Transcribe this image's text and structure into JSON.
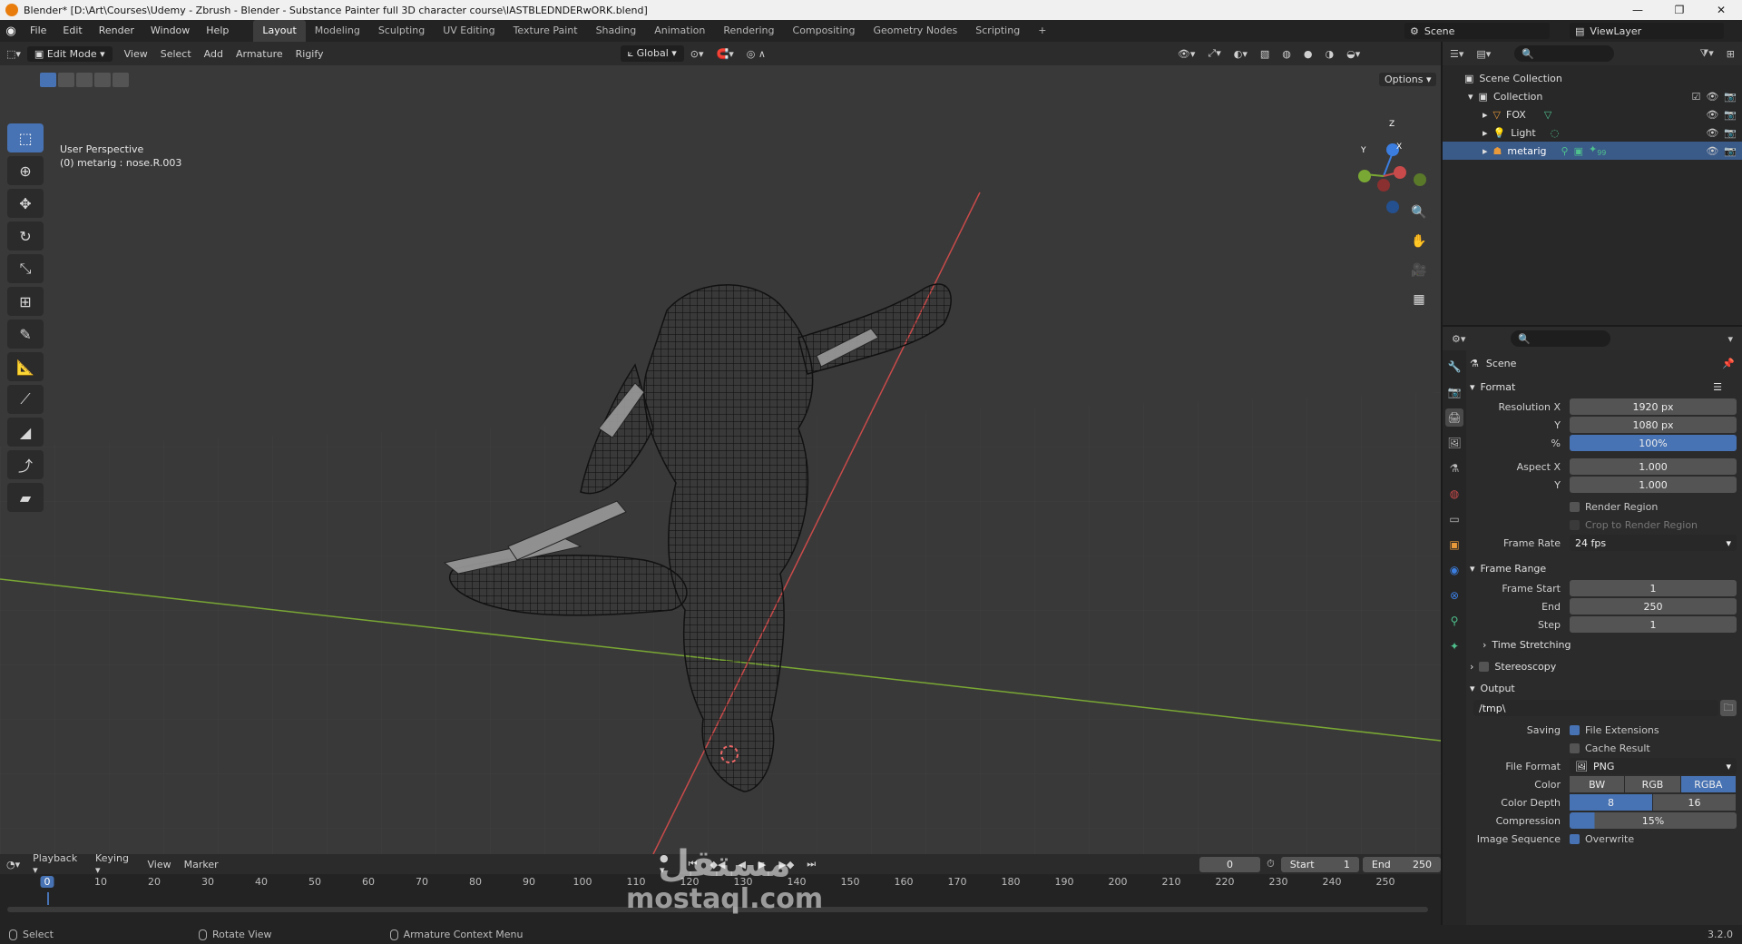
{
  "window": {
    "title": "Blender* [D:\\Art\\Courses\\Udemy - Zbrush - Blender - Substance Painter full 3D character course\\lASTBLEDNDERwORK.blend]",
    "minimize": "—",
    "maximize": "❐",
    "close": "✕"
  },
  "menu": [
    "File",
    "Edit",
    "Render",
    "Window",
    "Help"
  ],
  "workspaces": [
    "Layout",
    "Modeling",
    "Sculpting",
    "UV Editing",
    "Texture Paint",
    "Shading",
    "Animation",
    "Rendering",
    "Compositing",
    "Geometry Nodes",
    "Scripting"
  ],
  "workspace_add": "+",
  "scene_name": "Scene",
  "view_layer": "ViewLayer",
  "viewport": {
    "mode": "Edit Mode",
    "menus": [
      "View",
      "Select",
      "Add",
      "Armature",
      "Rigify"
    ],
    "orientation": "Global",
    "options": "Options",
    "perspective": "User Perspective",
    "active": "(0) metarig : nose.R.003",
    "gizmo": {
      "x": "X",
      "y": "Y",
      "z": "Z"
    }
  },
  "outliner": {
    "root": "Scene Collection",
    "collection": "Collection",
    "items": [
      "FOX",
      "Light",
      "metarig"
    ],
    "bone_count": "99"
  },
  "properties": {
    "context": "Scene",
    "format": {
      "title": "Format",
      "res_x_label": "Resolution X",
      "res_x": "1920 px",
      "res_y_label": "Y",
      "res_y": "1080 px",
      "pct_label": "%",
      "pct": "100%",
      "aspect_x_label": "Aspect X",
      "aspect_x": "1.000",
      "aspect_y_label": "Y",
      "aspect_y": "1.000",
      "render_region": "Render Region",
      "crop": "Crop to Render Region",
      "frame_rate_label": "Frame Rate",
      "frame_rate": "24 fps"
    },
    "frame_range": {
      "title": "Frame Range",
      "start_label": "Frame Start",
      "start": "1",
      "end_label": "End",
      "end": "250",
      "step_label": "Step",
      "step": "1",
      "time_stretching": "Time Stretching"
    },
    "stereoscopy": "Stereoscopy",
    "output": {
      "title": "Output",
      "path": "/tmp\\",
      "saving_label": "Saving",
      "file_ext": "File Extensions",
      "cache": "Cache Result",
      "file_format_label": "File Format",
      "file_format": "PNG",
      "color_label": "Color",
      "color_opts": [
        "BW",
        "RGB",
        "RGBA"
      ],
      "depth_label": "Color Depth",
      "depth_opts": [
        "8",
        "16"
      ],
      "compression_label": "Compression",
      "compression": "15%",
      "image_seq_label": "Image Sequence",
      "overwrite": "Overwrite"
    }
  },
  "timeline": {
    "menus": [
      "Playback",
      "Keying",
      "View",
      "Marker"
    ],
    "current": "0",
    "start_label": "Start",
    "start": "1",
    "end_label": "End",
    "end": "250",
    "ticks": [
      "0",
      "10",
      "20",
      "30",
      "40",
      "50",
      "60",
      "70",
      "80",
      "90",
      "100",
      "110",
      "120",
      "130",
      "140",
      "150",
      "160",
      "170",
      "180",
      "190",
      "200",
      "210",
      "220",
      "230",
      "240",
      "250"
    ]
  },
  "status": {
    "select": "Select",
    "rotate": "Rotate View",
    "context": "Armature Context Menu",
    "version": "3.2.0"
  },
  "watermark": {
    "arabic": "مستقل",
    "latin": "mostaql.com"
  },
  "colors": {
    "accent": "#4772b3",
    "selection": "#3a5a88",
    "x_axis": "#c94a4a",
    "y_axis": "#7aa834",
    "z_axis": "#3b7ee0"
  }
}
